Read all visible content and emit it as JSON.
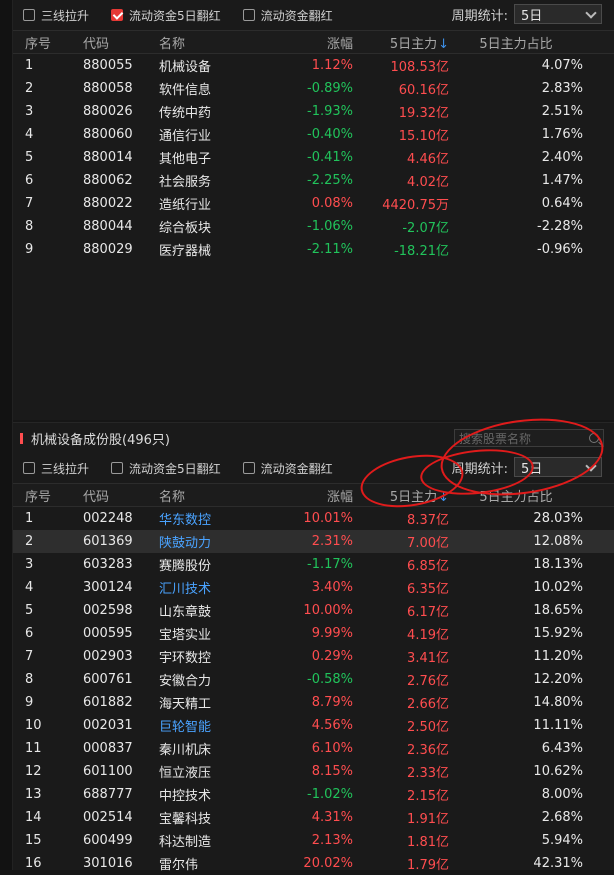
{
  "top": {
    "checkboxes": [
      {
        "label": "三线拉升",
        "checked": false
      },
      {
        "label": "流动资金5日翻红",
        "checked": true
      },
      {
        "label": "流动资金翻红",
        "checked": false
      }
    ],
    "period_label": "周期统计:",
    "period_value": "5日",
    "headers": {
      "idx": "序号",
      "code": "代码",
      "name": "名称",
      "chg": "涨幅",
      "main": "5日主力",
      "ratio": "5日主力占比"
    },
    "rows": [
      {
        "idx": "1",
        "code": "880055",
        "name": "机械设备",
        "chg": "1.12%",
        "main": "108.53亿",
        "ratio": "4.07%"
      },
      {
        "idx": "2",
        "code": "880058",
        "name": "软件信息",
        "chg": "-0.89%",
        "main": "60.16亿",
        "ratio": "2.83%"
      },
      {
        "idx": "3",
        "code": "880026",
        "name": "传统中药",
        "chg": "-1.93%",
        "main": "19.32亿",
        "ratio": "2.51%"
      },
      {
        "idx": "4",
        "code": "880060",
        "name": "通信行业",
        "chg": "-0.40%",
        "main": "15.10亿",
        "ratio": "1.76%"
      },
      {
        "idx": "5",
        "code": "880014",
        "name": "其他电子",
        "chg": "-0.41%",
        "main": "4.46亿",
        "ratio": "2.40%"
      },
      {
        "idx": "6",
        "code": "880062",
        "name": "社会服务",
        "chg": "-2.25%",
        "main": "4.02亿",
        "ratio": "1.47%"
      },
      {
        "idx": "7",
        "code": "880022",
        "name": "造纸行业",
        "chg": "0.08%",
        "main": "4420.75万",
        "ratio": "0.64%"
      },
      {
        "idx": "8",
        "code": "880044",
        "name": "综合板块",
        "chg": "-1.06%",
        "main": "-2.07亿",
        "ratio": "-2.28%"
      },
      {
        "idx": "9",
        "code": "880029",
        "name": "医疗器械",
        "chg": "-2.11%",
        "main": "-18.21亿",
        "ratio": "-0.96%"
      }
    ]
  },
  "bottom": {
    "group_title": "机械设备成份股(496只)",
    "search_placeholder": "搜索股票名称",
    "checkboxes": [
      {
        "label": "三线拉升",
        "checked": false
      },
      {
        "label": "流动资金5日翻红",
        "checked": false
      },
      {
        "label": "流动资金翻红",
        "checked": false
      }
    ],
    "period_label": "周期统计:",
    "period_value": "5日",
    "headers": {
      "idx": "序号",
      "code": "代码",
      "name": "名称",
      "chg": "涨幅",
      "main": "5日主力",
      "ratio": "5日主力占比"
    },
    "rows": [
      {
        "idx": "1",
        "code": "002248",
        "name": "华东数控",
        "chg": "10.01%",
        "main": "8.37亿",
        "ratio": "28.03%",
        "blue": true
      },
      {
        "idx": "2",
        "code": "601369",
        "name": "陕鼓动力",
        "chg": "2.31%",
        "main": "7.00亿",
        "ratio": "12.08%",
        "blue": true
      },
      {
        "idx": "3",
        "code": "603283",
        "name": "赛腾股份",
        "chg": "-1.17%",
        "main": "6.85亿",
        "ratio": "18.13%",
        "blue": false
      },
      {
        "idx": "4",
        "code": "300124",
        "name": "汇川技术",
        "chg": "3.40%",
        "main": "6.35亿",
        "ratio": "10.02%",
        "blue": true
      },
      {
        "idx": "5",
        "code": "002598",
        "name": "山东章鼓",
        "chg": "10.00%",
        "main": "6.17亿",
        "ratio": "18.65%",
        "blue": false
      },
      {
        "idx": "6",
        "code": "000595",
        "name": "宝塔实业",
        "chg": "9.99%",
        "main": "4.19亿",
        "ratio": "15.92%",
        "blue": false
      },
      {
        "idx": "7",
        "code": "002903",
        "name": "宇环数控",
        "chg": "0.29%",
        "main": "3.41亿",
        "ratio": "11.20%",
        "blue": false
      },
      {
        "idx": "8",
        "code": "600761",
        "name": "安徽合力",
        "chg": "-0.58%",
        "main": "2.76亿",
        "ratio": "12.20%",
        "blue": false
      },
      {
        "idx": "9",
        "code": "601882",
        "name": "海天精工",
        "chg": "8.79%",
        "main": "2.66亿",
        "ratio": "14.80%",
        "blue": false
      },
      {
        "idx": "10",
        "code": "002031",
        "name": "巨轮智能",
        "chg": "4.56%",
        "main": "2.50亿",
        "ratio": "11.11%",
        "blue": true
      },
      {
        "idx": "11",
        "code": "000837",
        "name": "秦川机床",
        "chg": "6.10%",
        "main": "2.36亿",
        "ratio": "6.43%",
        "blue": false
      },
      {
        "idx": "12",
        "code": "601100",
        "name": "恒立液压",
        "chg": "8.15%",
        "main": "2.33亿",
        "ratio": "10.62%",
        "blue": false
      },
      {
        "idx": "13",
        "code": "688777",
        "name": "中控技术",
        "chg": "-1.02%",
        "main": "2.15亿",
        "ratio": "8.00%",
        "blue": false
      },
      {
        "idx": "14",
        "code": "002514",
        "name": "宝馨科技",
        "chg": "4.31%",
        "main": "1.91亿",
        "ratio": "2.68%",
        "blue": false
      },
      {
        "idx": "15",
        "code": "600499",
        "name": "科达制造",
        "chg": "2.13%",
        "main": "1.81亿",
        "ratio": "5.94%",
        "blue": false
      },
      {
        "idx": "16",
        "code": "301016",
        "name": "雷尔伟",
        "chg": "20.02%",
        "main": "1.79亿",
        "ratio": "42.31%",
        "blue": false
      }
    ]
  },
  "colors": {
    "up": "#ff4d4f",
    "down": "#21c35b",
    "link": "#4aa3ff",
    "annotation": "#e01b1b"
  }
}
